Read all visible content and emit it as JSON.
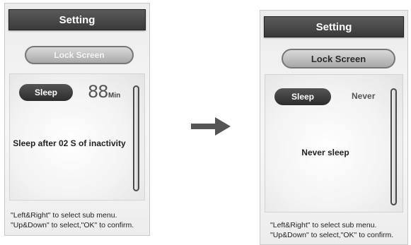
{
  "before": {
    "title": "Setting",
    "menu_item": "Lock Screen",
    "tab_label": "Sleep",
    "value": "88",
    "unit": "Min",
    "message": "Sleep after 02 S of inactivity",
    "hint_line1": "\"Left&Right\" to select sub menu.",
    "hint_line2": "\"Up&Down\" to select,\"OK\" to confirm."
  },
  "after": {
    "title": "Setting",
    "menu_item": "Lock Screen",
    "tab_label": "Sleep",
    "value": "Never",
    "message": "Never sleep",
    "hint_line1": "\"Left&Right\" to select sub menu.",
    "hint_line2": "\"Up&Down\" to select,\"OK\" to confirm."
  },
  "colors": {
    "title_bar": "#3a3a3a",
    "tab": "#2c2c2c",
    "arrow": "#555555"
  },
  "icons": {
    "arrow": "right-arrow-icon"
  }
}
